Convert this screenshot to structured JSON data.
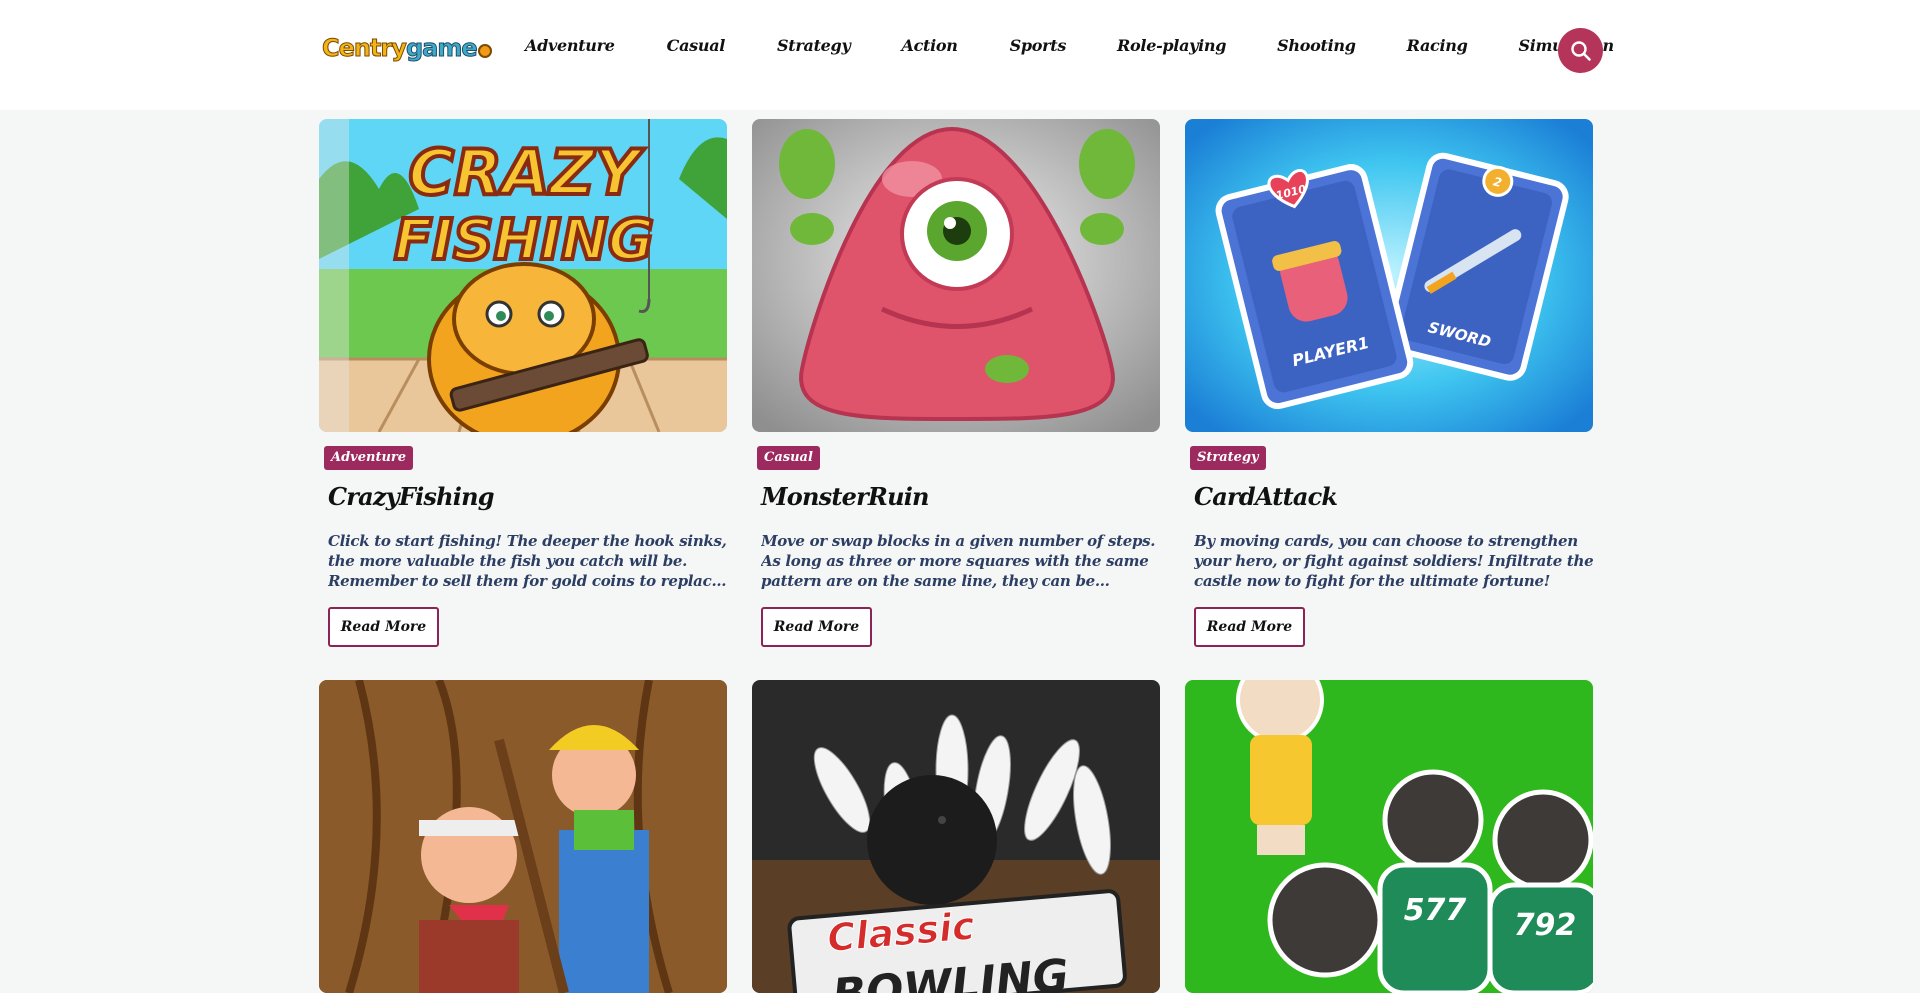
{
  "brand": {
    "logo_part1": "Centry",
    "logo_part2": "game"
  },
  "nav": {
    "items": [
      "Adventure",
      "Casual",
      "Strategy",
      "Action",
      "Sports",
      "Role-playing",
      "Shooting",
      "Racing",
      "Simulation"
    ]
  },
  "cards": [
    {
      "tag": "Adventure",
      "title": "CrazyFishing",
      "description": "Click to start fishing! The deeper the hook sinks, the more valuable the fish you catch will be. Remember to sell them for gold coins to replace them with more…",
      "button": "Read More",
      "image_text_line1": "CRAZY",
      "image_text_line2": "FISHING"
    },
    {
      "tag": "Casual",
      "title": "MonsterRuin",
      "description": "Move or swap blocks in a given number of steps. As long as three or more squares with the same pattern are on the same line, they can be eliminated…",
      "button": "Read More"
    },
    {
      "tag": "Strategy",
      "title": "CardAttack",
      "description": "By moving cards, you can choose to strengthen your hero, or fight against soldiers! Infiltrate the castle now to fight for the ultimate fortune!",
      "button": "Read More",
      "image_card1_top": "1010",
      "image_card1_label": "PLAYER1",
      "image_card2_top": "2",
      "image_card2_label": "SWORD"
    }
  ],
  "second_row_images": {
    "bowling_line1": "Classic",
    "bowling_line2": "BOWLING",
    "jersey1": "577",
    "jersey2": "792"
  },
  "colors": {
    "accent": "#9c2a5e",
    "search": "#b5345a",
    "description": "#2c3e63",
    "background": "#f5f6f6"
  }
}
